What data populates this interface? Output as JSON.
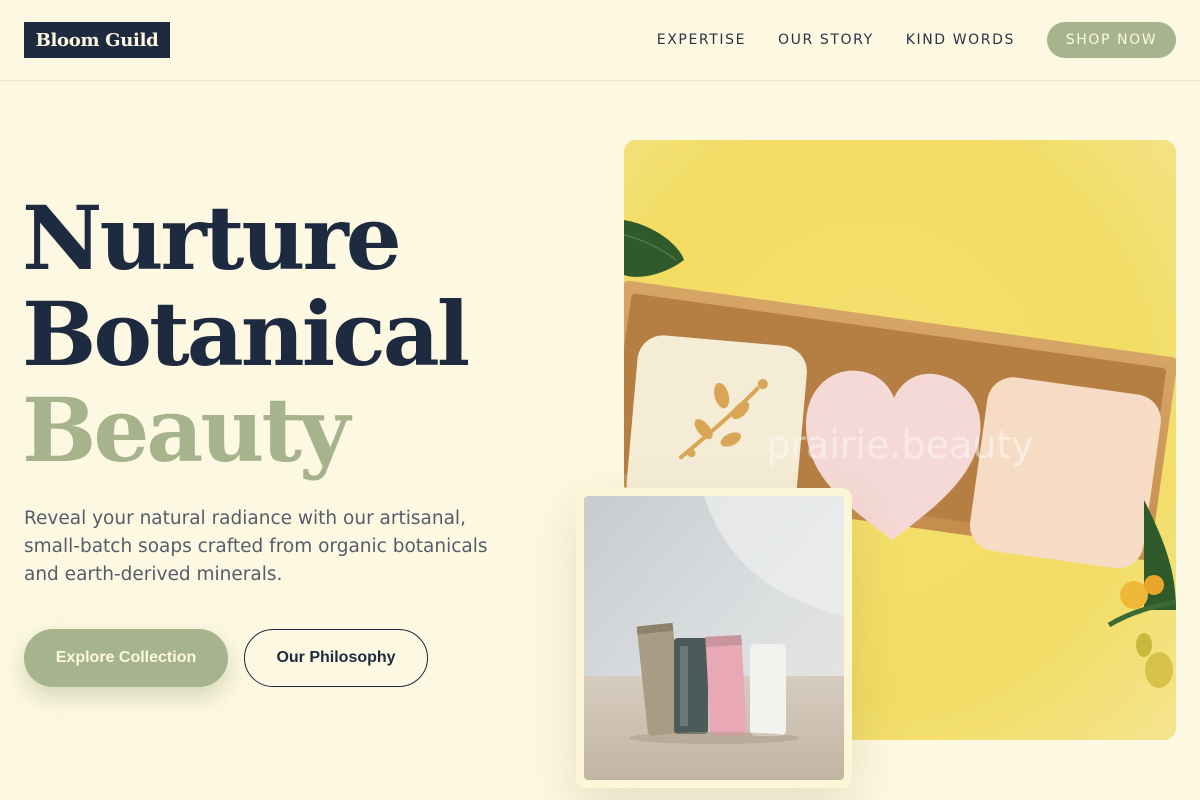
{
  "brand": {
    "name": "Bloom Guild"
  },
  "nav": {
    "links": [
      "EXPERTISE",
      "OUR STORY",
      "KIND WORDS"
    ],
    "cta": "SHOP NOW"
  },
  "hero": {
    "title_lines": [
      "Nurture",
      "Botanical",
      "Beauty"
    ],
    "description": "Reveal your natural radiance with our artisanal, small-batch soaps crafted from organic botanicals and earth-derived minerals.",
    "primary_button": "Explore Collection",
    "secondary_button": "Our Philosophy"
  },
  "images": {
    "main_photo_watermark": "prairie.beauty",
    "main_photo_subject": "three soap bars in a kraft box on yellow background",
    "small_photo_subject": "stack of handmade soap bars on stone"
  },
  "colors": {
    "background": "#fdf8e1",
    "navy": "#1e2a3f",
    "sage": "#a6b38d",
    "body_text": "#555d6a"
  }
}
